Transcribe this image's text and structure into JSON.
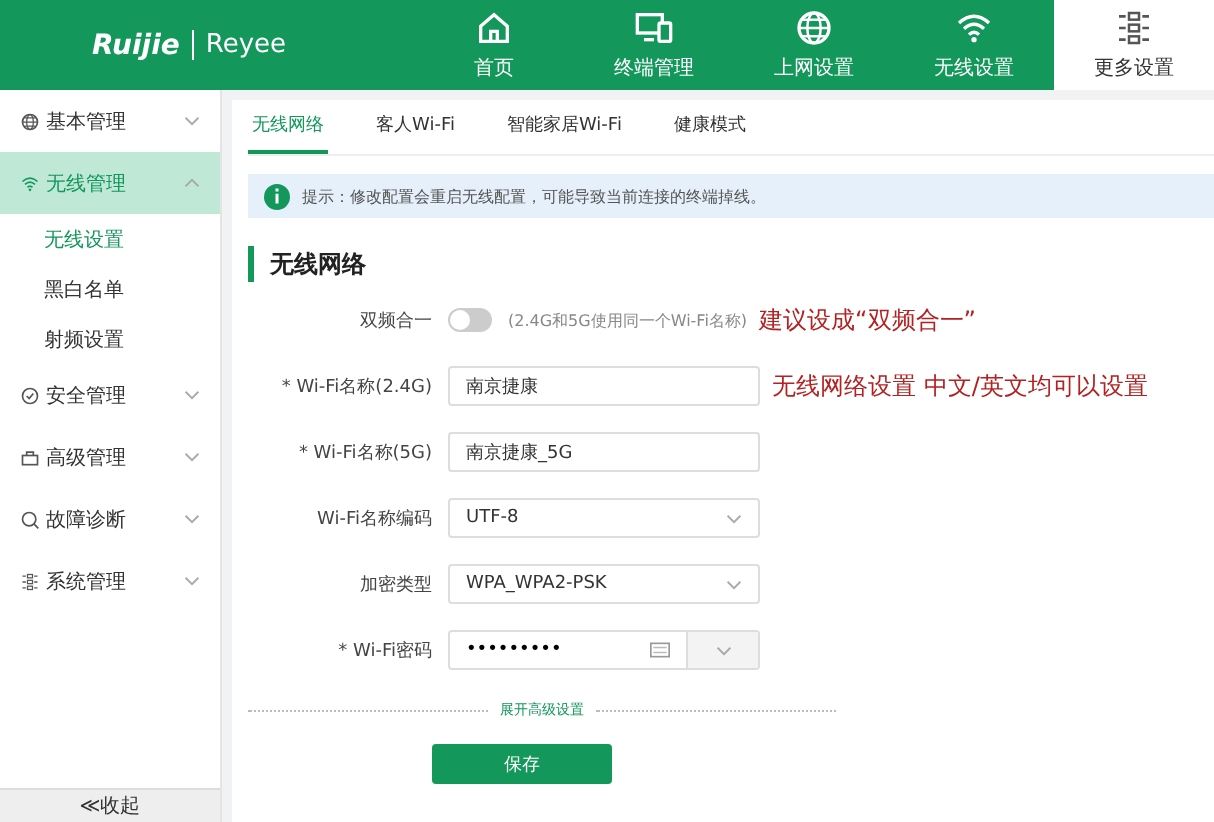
{
  "header": {
    "logo": "Ruijie",
    "sublogo": "Reyee",
    "nav": [
      {
        "label": "首页",
        "selected": false
      },
      {
        "label": "终端管理",
        "selected": false
      },
      {
        "label": "上网设置",
        "selected": false
      },
      {
        "label": "无线设置",
        "selected": false
      },
      {
        "label": "更多设置",
        "selected": true
      }
    ]
  },
  "sidebar": {
    "items": [
      {
        "label": "基本管理",
        "expanded": false,
        "selected": false
      },
      {
        "label": "无线管理",
        "expanded": true,
        "selected": true,
        "children": [
          {
            "label": "无线设置",
            "selected": true
          },
          {
            "label": "黑白名单",
            "selected": false
          },
          {
            "label": "射频设置",
            "selected": false
          }
        ]
      },
      {
        "label": "安全管理",
        "expanded": false,
        "selected": false
      },
      {
        "label": "高级管理",
        "expanded": false,
        "selected": false
      },
      {
        "label": "故障诊断",
        "expanded": false,
        "selected": false
      },
      {
        "label": "系统管理",
        "expanded": false,
        "selected": false
      }
    ],
    "collapse": "≪收起"
  },
  "tabs": [
    {
      "label": "无线网络",
      "selected": true
    },
    {
      "label": "客人Wi-Fi",
      "selected": false
    },
    {
      "label": "智能家居Wi-Fi",
      "selected": false
    },
    {
      "label": "健康模式",
      "selected": false
    }
  ],
  "notice": "提示：修改配置会重启无线配置，可能导致当前连接的终端掉线。",
  "section_title": "无线网络",
  "form": [
    {
      "kind": "toggle",
      "label": "双频合一",
      "on": false,
      "hint": "(2.4G和5G使用同一个Wi-Fi名称)",
      "annotation": "建议设成“双频合一”"
    },
    {
      "kind": "text",
      "label": "* Wi-Fi名称(2.4G)",
      "value": "南京捷康",
      "annotation": "无线网络设置 中文/英文均可以设置"
    },
    {
      "kind": "text",
      "label": "* Wi-Fi名称(5G)",
      "value": "南京捷康_5G"
    },
    {
      "kind": "select",
      "label": "Wi-Fi名称编码",
      "value": "UTF-8"
    },
    {
      "kind": "select",
      "label": "加密类型",
      "value": "WPA_WPA2-PSK"
    },
    {
      "kind": "password",
      "label": "* Wi-Fi密码",
      "value": "•••••••••"
    }
  ],
  "advanced_link": "展开高级设置",
  "save_button": "保存"
}
